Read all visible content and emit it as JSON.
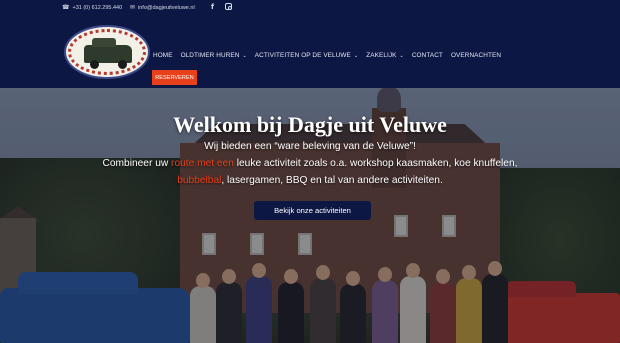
{
  "topbar": {
    "phone": "+31 (0) 612.295.440",
    "email": "info@dagjeuitveluwe.nl",
    "social": [
      "facebook-icon",
      "instagram-icon"
    ]
  },
  "nav": {
    "items": [
      {
        "label": "HOME",
        "dropdown": false
      },
      {
        "label": "OLDTIMER HUREN",
        "dropdown": true
      },
      {
        "label": "ACTIVITEITEN OP DE VELUWE",
        "dropdown": true
      },
      {
        "label": "ZAKELIJK",
        "dropdown": true
      },
      {
        "label": "CONTACT",
        "dropdown": false
      },
      {
        "label": "OVERNACHTEN",
        "dropdown": false
      }
    ],
    "reserve_label": "RESERVEREN"
  },
  "hero": {
    "title": "Welkom bij Dagje uit Veluwe",
    "line1": "Wij bieden een “ware beleving van de Veluwe”!",
    "line2_pre": "Combineer uw ",
    "line2_hl": "route met een",
    "line2_post": " leuke activiteit zoals o.a. workshop kaasmaken, koe knuffelen,",
    "line3_hl": "bubbelbal",
    "line3_post": ", lasergamen, BBQ en tal van andere activiteiten.",
    "cta_label": "Bekijk onze activiteiten"
  },
  "colors": {
    "navy": "#0c1744",
    "accent": "#e8401a",
    "text_light": "#ffffff"
  }
}
